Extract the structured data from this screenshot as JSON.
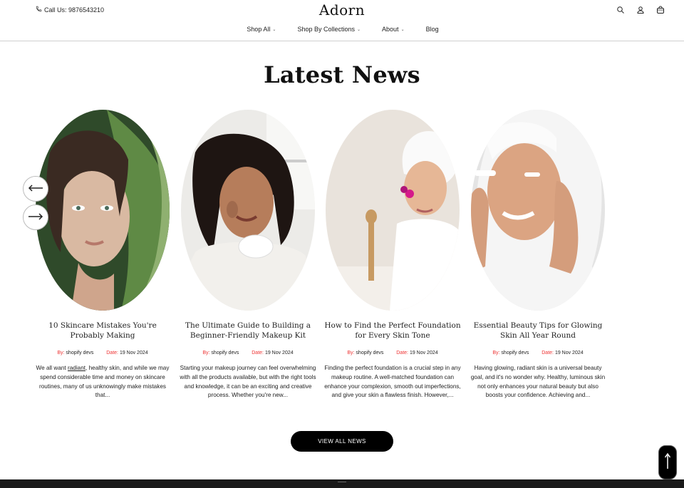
{
  "header": {
    "phone_text": "Call Us: 9876543210",
    "logo": "Adorn",
    "icons": [
      "search-icon",
      "user-icon",
      "cart-icon"
    ]
  },
  "nav": {
    "items": [
      {
        "label": "Shop All",
        "dropdown": true
      },
      {
        "label": "Shop By Collections",
        "dropdown": true
      },
      {
        "label": "About",
        "dropdown": true
      },
      {
        "label": "Blog",
        "dropdown": false
      }
    ]
  },
  "section": {
    "title": "Latest News",
    "view_all_label": "VIEW ALL NEWS"
  },
  "posts": [
    {
      "title": "10 Skincare Mistakes You're Probably Making",
      "by_label": "By:",
      "author": "shopify devs",
      "date_label": "Date:",
      "date": "19 Nov 2024",
      "excerpt_pre": "We all want ",
      "excerpt_link": "radiant",
      "excerpt_post": ", healthy skin, and while we may spend considerable time and money on skincare routines, many of us unknowingly make mistakes that..."
    },
    {
      "title": "The Ultimate Guide to Building a Beginner-Friendly Makeup Kit",
      "by_label": "By:",
      "author": "shopify devs",
      "date_label": "Date:",
      "date": "19 Nov 2024",
      "excerpt": "Starting your makeup journey can feel overwhelming with all the products available, but with the right tools and knowledge, it can be an exciting and creative process. Whether you're new..."
    },
    {
      "title": "How to Find the Perfect Foundation for Every Skin Tone",
      "by_label": "By:",
      "author": "shopify devs",
      "date_label": "Date:",
      "date": "19 Nov 2024",
      "excerpt": "Finding the perfect foundation is a crucial step in any makeup routine. A well-matched foundation can enhance your complexion, smooth out imperfections, and give your skin a flawless finish. However,..."
    },
    {
      "title": "Essential Beauty Tips for Glowing Skin All Year Round",
      "by_label": "By:",
      "author": "shopify devs",
      "date_label": "Date:",
      "date": "19 Nov 2024",
      "excerpt": "Having glowing, radiant skin is a universal beauty goal, and it's no wonder why. Healthy, luminous skin not only enhances your natural beauty but also boosts your confidence. Achieving and..."
    }
  ],
  "controls": {
    "prev_icon": "arrow-left-icon",
    "next_icon": "arrow-right-icon",
    "to_top_icon": "arrow-up-icon"
  },
  "colors": {
    "accent_label": "#e33333",
    "button_bg": "#000000",
    "text": "#111111"
  }
}
